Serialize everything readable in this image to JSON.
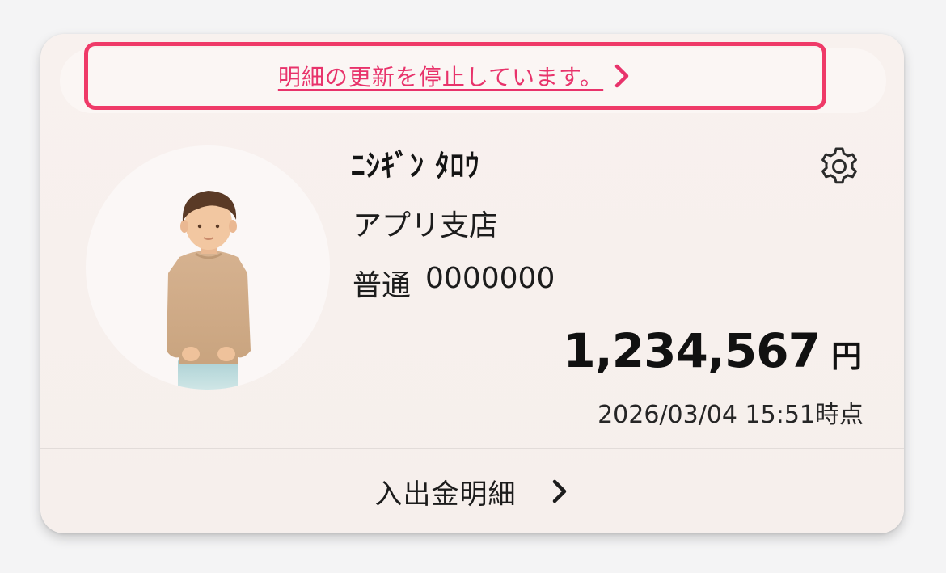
{
  "notice": {
    "text": "明細の更新を停止しています。",
    "icon": "chevron-right-icon",
    "color": "#e8336b",
    "highlight_color": "#ef3a68"
  },
  "account": {
    "holder_name": "ﾆｼｷﾞﾝ ﾀﾛｳ",
    "branch": "アプリ支店",
    "type": "普通",
    "number": "0000000",
    "settings_icon": "gear-icon",
    "avatar_icon": "person-avatar-icon"
  },
  "balance": {
    "amount": "1,234,567",
    "unit": "円",
    "as_of": "2026/03/04 15:51時点"
  },
  "footer": {
    "link_label": "入出金明細",
    "icon": "chevron-right-icon"
  }
}
